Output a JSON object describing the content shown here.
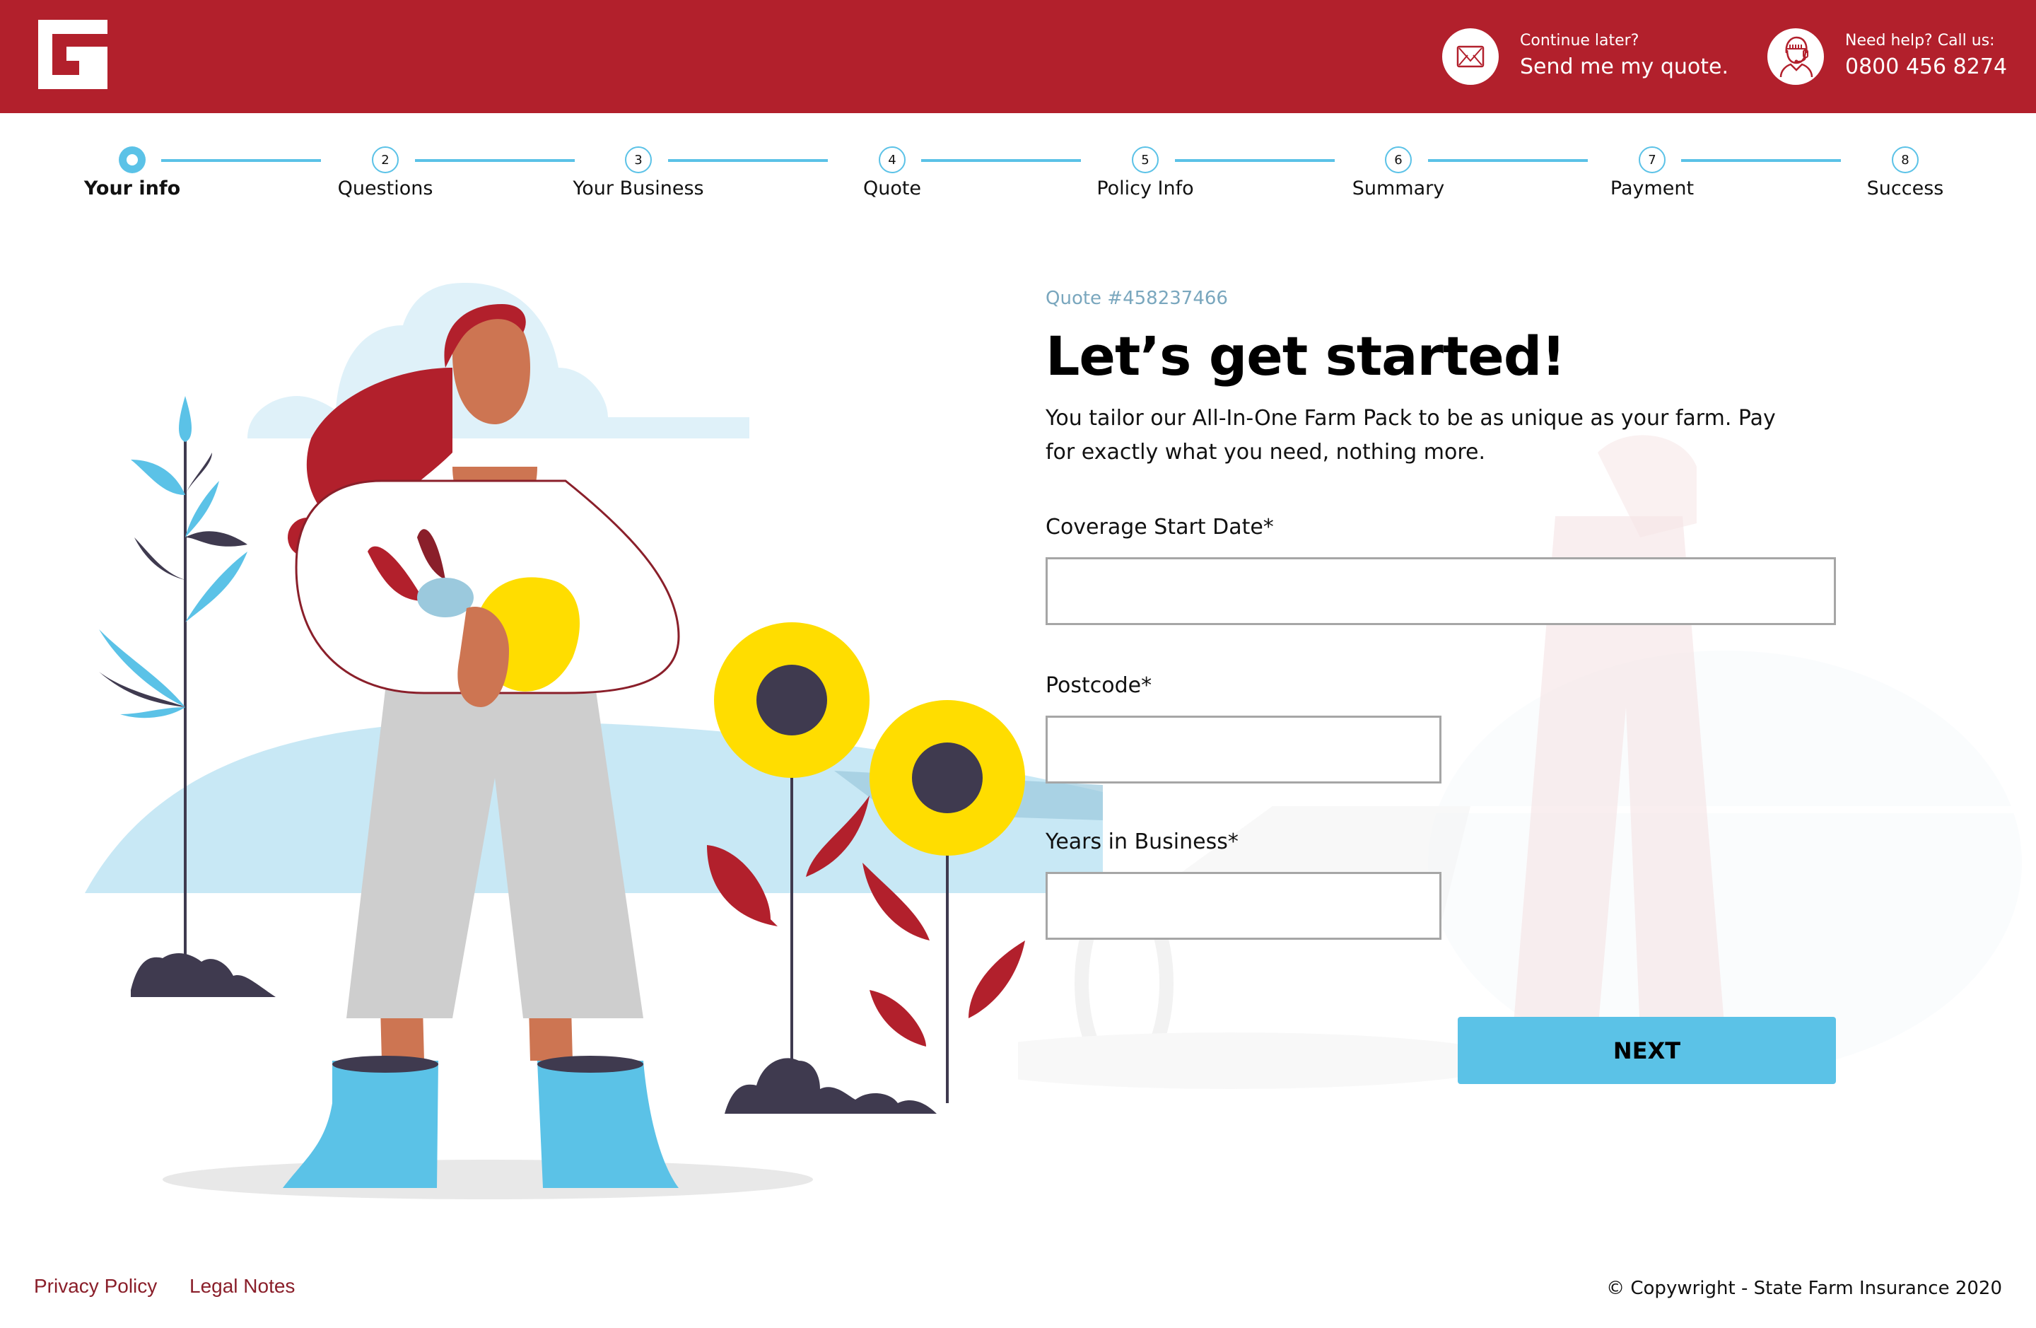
{
  "header": {
    "logo_icon": "brand-logo-icon",
    "continue": {
      "icon": "envelope-icon",
      "small": "Continue later?",
      "big": "Send me my quote."
    },
    "help": {
      "icon": "support-agent-icon",
      "small": "Need help? Call us:",
      "big": "0800 456 8274"
    }
  },
  "stepper": {
    "current": 1,
    "steps": [
      {
        "number": "1",
        "label": "Your info",
        "active": true
      },
      {
        "number": "2",
        "label": "Questions"
      },
      {
        "number": "3",
        "label": "Your Business"
      },
      {
        "number": "4",
        "label": "Quote"
      },
      {
        "number": "5",
        "label": "Policy Info"
      },
      {
        "number": "6",
        "label": "Summary"
      },
      {
        "number": "7",
        "label": "Payment"
      },
      {
        "number": "8",
        "label": "Success"
      }
    ]
  },
  "form": {
    "quote_number": "Quote #458237466",
    "title": "Let’s get started!",
    "intro": "You tailor our All-In-One Farm Pack to be as unique as your farm. Pay for exactly what you need, nothing more.",
    "fields": [
      {
        "label": "Coverage Start Date*",
        "value": "",
        "placeholder": ""
      },
      {
        "label": "Postcode*",
        "value": "",
        "placeholder": ""
      },
      {
        "label": "Years in Business*",
        "value": "",
        "placeholder": ""
      }
    ],
    "next_label": "NEXT"
  },
  "footer": {
    "privacy": "Privacy Policy",
    "legal": "Legal Notes",
    "copyright": "© Copywright - State Farm Insurance 2020"
  },
  "colors": {
    "brand_red": "#b2202c",
    "accent_blue": "#5bc2e7",
    "footer_link": "#8a1f2a",
    "quote_number": "#7aa7be"
  }
}
